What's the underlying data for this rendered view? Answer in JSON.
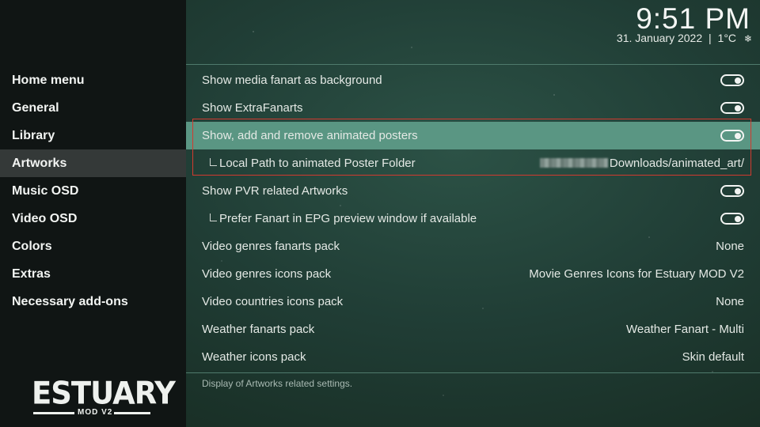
{
  "header": {
    "time": "9:51 PM",
    "date": "31. January 2022",
    "separator": "|",
    "temperature": "1°C",
    "weather_icon": "snowflake-icon",
    "weather_glyph": "❄"
  },
  "sidebar": {
    "items": [
      {
        "label": "Home menu"
      },
      {
        "label": "General"
      },
      {
        "label": "Library"
      },
      {
        "label": "Artworks",
        "active": true
      },
      {
        "label": "Music OSD"
      },
      {
        "label": "Video OSD"
      },
      {
        "label": "Colors"
      },
      {
        "label": "Extras"
      },
      {
        "label": "Necessary add-ons"
      }
    ],
    "logo": {
      "title": "ESTUARY",
      "subtitle": "MOD V2"
    }
  },
  "settings": {
    "rows": [
      {
        "label": "Show media fanart as background",
        "type": "toggle",
        "on": true
      },
      {
        "label": "Show ExtraFanarts",
        "type": "toggle",
        "on": true
      },
      {
        "label": "Show, add and remove animated posters",
        "type": "toggle",
        "on": true,
        "focused": true
      },
      {
        "label": "Local Path to animated Poster Folder",
        "type": "value",
        "value": "Downloads/animated_art/",
        "sub": true
      },
      {
        "label": "Show PVR related Artworks",
        "type": "toggle",
        "on": true
      },
      {
        "label": "Prefer Fanart in EPG preview window if available",
        "type": "toggle",
        "on": true,
        "sub": true
      },
      {
        "label": "Video genres fanarts pack",
        "type": "value",
        "value": "None"
      },
      {
        "label": "Video genres icons pack",
        "type": "value",
        "value": "Movie Genres Icons for Estuary MOD V2"
      },
      {
        "label": "Video countries icons pack",
        "type": "value",
        "value": "None"
      },
      {
        "label": "Weather fanarts pack",
        "type": "value",
        "value": "Weather Fanart - Multi"
      },
      {
        "label": "Weather icons pack",
        "type": "value",
        "value": "Skin default"
      }
    ],
    "description": "Display of Artworks related settings."
  },
  "colors": {
    "focus_row": "#5a9683",
    "sidebar_bg": "#101514",
    "sidebar_active": "#343938",
    "annotation_box": "#d23a2f"
  }
}
